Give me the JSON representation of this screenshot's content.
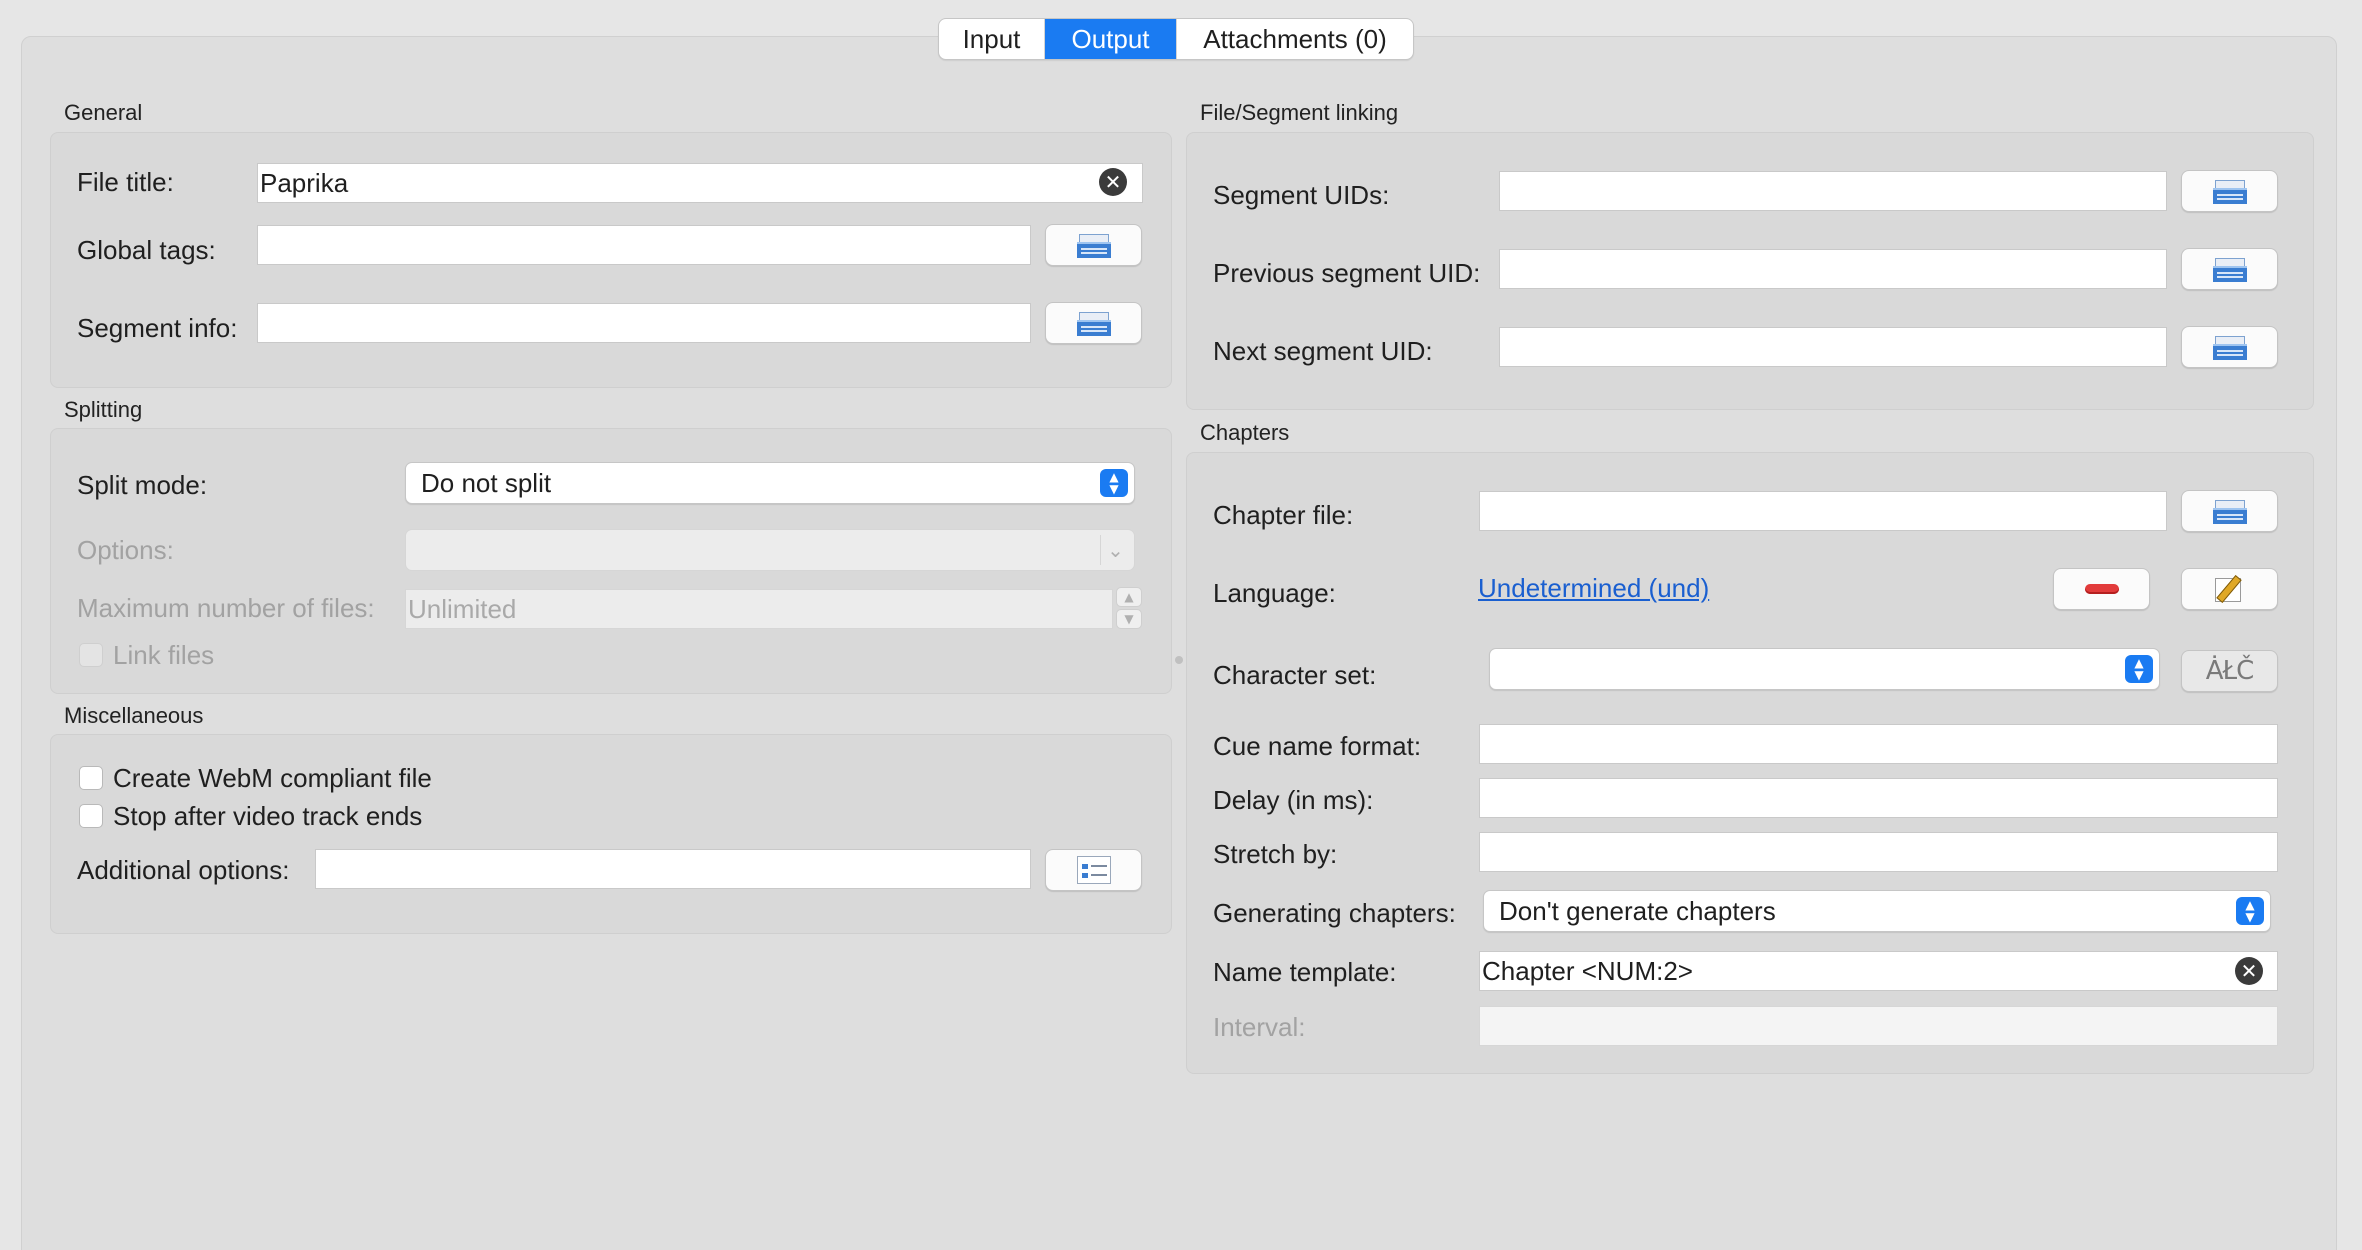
{
  "tabs": {
    "input": "Input",
    "output": "Output",
    "attachments": "Attachments (0)"
  },
  "accent_color": "#1a7bf2",
  "general": {
    "title": "General",
    "file_title_label": "File title:",
    "file_title_value": "Paprika",
    "global_tags_label": "Global tags:",
    "segment_info_label": "Segment info:"
  },
  "splitting": {
    "title": "Splitting",
    "split_mode_label": "Split mode:",
    "split_mode_value": "Do not split",
    "options_label": "Options:",
    "max_files_label": "Maximum number of files:",
    "max_files_placeholder": "Unlimited",
    "link_files_label": "Link files"
  },
  "misc": {
    "title": "Miscellaneous",
    "webm_label": "Create WebM compliant file",
    "stop_label": "Stop after video track ends",
    "additional_label": "Additional options:"
  },
  "linking": {
    "title": "File/Segment linking",
    "segment_uids_label": "Segment UIDs:",
    "prev_uid_label": "Previous segment UID:",
    "next_uid_label": "Next segment UID:"
  },
  "chapters": {
    "title": "Chapters",
    "chapter_file_label": "Chapter file:",
    "language_label": "Language:",
    "language_value": "Undetermined (und)",
    "charset_label": "Character set:",
    "cue_format_label": "Cue name format:",
    "delay_label": "Delay (in ms):",
    "stretch_label": "Stretch by:",
    "generating_label": "Generating chapters:",
    "generating_value": "Don't generate chapters",
    "name_template_label": "Name template:",
    "name_template_value": "Chapter <NUM:2>",
    "interval_label": "Interval:"
  },
  "icons": {
    "clear": "clear-icon",
    "browse": "folder-icon",
    "remove": "remove-icon",
    "edit": "pencil-icon",
    "charset": "charset-icon",
    "options": "options-list-icon",
    "charset_glyph": "ȦŁČ",
    "clear_glyph": "✕"
  }
}
